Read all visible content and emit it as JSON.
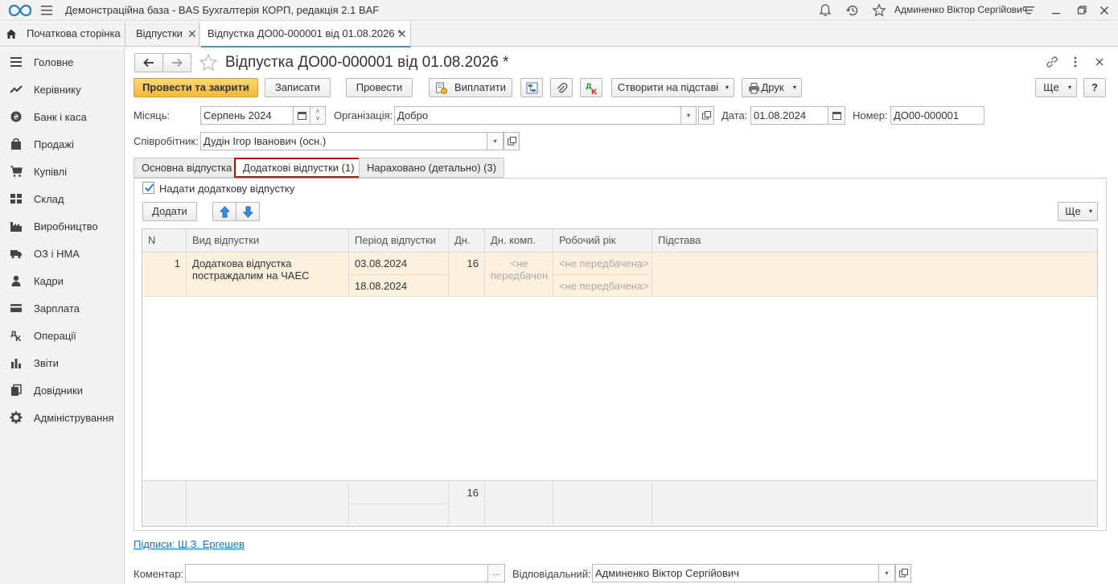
{
  "titlebar": {
    "app_title": "Демонстраційна база - BAS Бухгалтерія КОРП, редакція 2.1 BAF",
    "user": "Админенко Віктор Сергійович"
  },
  "tabs": {
    "home": "Початкова сторінка",
    "vacations": "Відпустки",
    "document": "Відпустка ДО00-000001 від 01.08.2026 *"
  },
  "sidebar": {
    "items": [
      {
        "label": "Головне",
        "icon": "menu-lines-icon"
      },
      {
        "label": "Керівнику",
        "icon": "trend-icon"
      },
      {
        "label": "Банк і каса",
        "icon": "coin-icon"
      },
      {
        "label": "Продажі",
        "icon": "bag-icon"
      },
      {
        "label": "Купівлі",
        "icon": "cart-icon"
      },
      {
        "label": "Склад",
        "icon": "warehouse-icon"
      },
      {
        "label": "Виробництво",
        "icon": "factory-icon"
      },
      {
        "label": "ОЗ і НМА",
        "icon": "truck-icon"
      },
      {
        "label": "Кадри",
        "icon": "person-icon"
      },
      {
        "label": "Зарплата",
        "icon": "card-icon"
      },
      {
        "label": "Операції",
        "icon": "operations-icon"
      },
      {
        "label": "Звіти",
        "icon": "bar-chart-icon"
      },
      {
        "label": "Довідники",
        "icon": "books-icon"
      },
      {
        "label": "Адміністрування",
        "icon": "gear-icon"
      }
    ]
  },
  "form": {
    "title": "Відпустка ДО00-000001 від 01.08.2026 *",
    "toolbar": {
      "post_close": "Провести та закрити",
      "save": "Записати",
      "post": "Провести",
      "pay": "Виплатити",
      "create_based": "Створити на підставі",
      "print": "Друк",
      "more": "Ще",
      "help": "?"
    },
    "fields": {
      "month_label": "Місяць:",
      "month_value": "Серпень 2024",
      "org_label": "Організація:",
      "org_value": "Добро",
      "date_label": "Дата:",
      "date_value": "01.08.2024",
      "number_label": "Номер:",
      "number_value": "ДО00-000001",
      "employee_label": "Співробітник:",
      "employee_value": "Дудін Ігор Іванович (осн.)"
    },
    "form_tabs": {
      "main": "Основна відпустка",
      "additional": "Додаткові відпустки (1)",
      "accrued": "Нараховано (детально) (3)"
    },
    "grant_checkbox": "Надати додаткову відпустку",
    "grant_checked": true,
    "add_button": "Додати",
    "table_more": "Ще",
    "table": {
      "headers": [
        "N",
        "Вид відпустки",
        "Період відпустки",
        "Дн.",
        "Дн. комп.",
        "Робочий рік",
        "Підстава"
      ],
      "row": {
        "n": "1",
        "type_line1": "Додаткова відпустка",
        "type_line2": "постраждалим на ЧАЕС",
        "period_from": "03.08.2024",
        "period_to": "18.08.2024",
        "days": "16",
        "comp_line1": "<не",
        "comp_line2": "передбачен",
        "work_year_1": "<не передбачена>",
        "work_year_2": "<не передбачена>"
      },
      "footer_days": "16"
    },
    "signatures_link": "Підписи: Ш.З. Ергешев",
    "comment_label": "Коментар:",
    "comment_value": "",
    "comment_btn": "...",
    "responsible_label": "Відповідальний:",
    "responsible_value": "Админенко Віктор Сергійович"
  }
}
